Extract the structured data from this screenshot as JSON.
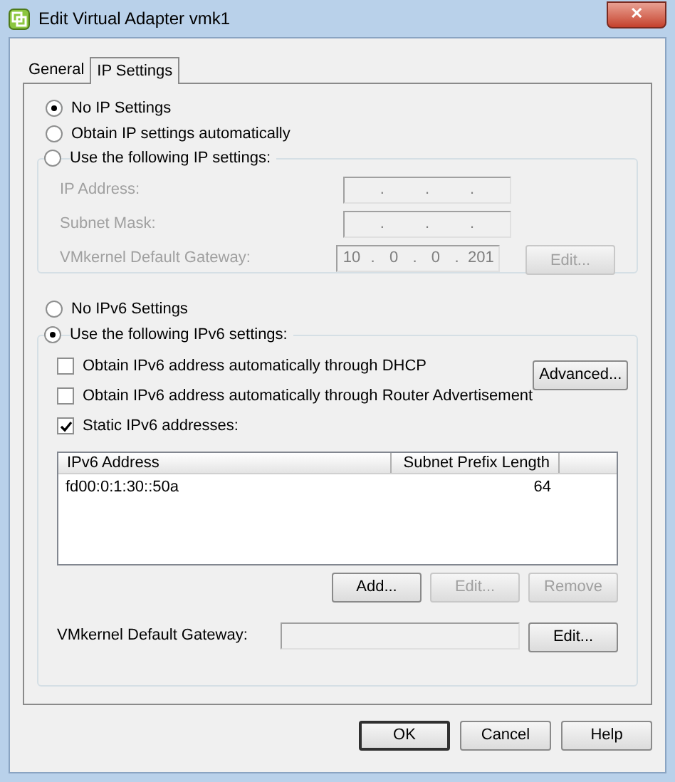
{
  "window": {
    "title": "Edit Virtual Adapter vmk1",
    "close": "✕"
  },
  "tabs": [
    {
      "label": "General",
      "selected": false
    },
    {
      "label": "IP Settings",
      "selected": true
    }
  ],
  "ipv4": {
    "options": [
      {
        "label": "No IP Settings",
        "selected": true
      },
      {
        "label": "Obtain IP settings automatically",
        "selected": false
      },
      {
        "label": "Use the following IP settings:",
        "selected": false
      }
    ],
    "fields": [
      {
        "label": "IP Address:",
        "disabled": true,
        "separators": [
          ".",
          ".",
          "."
        ]
      },
      {
        "label": "Subnet Mask:",
        "disabled": true,
        "separators": [
          ".",
          ".",
          "."
        ]
      },
      {
        "label": "VMkernel Default Gateway:",
        "disabled": true,
        "separators": [
          ".",
          ".",
          "."
        ],
        "octets": [
          "10",
          "0",
          "0",
          "201"
        ],
        "button": {
          "label": "Edit...",
          "disabled": true
        }
      }
    ]
  },
  "ipv6": {
    "options": [
      {
        "label": "No IPv6 Settings",
        "selected": false
      },
      {
        "label": "Use the following IPv6 settings:",
        "selected": true
      }
    ],
    "checkboxes": [
      {
        "label": "Obtain IPv6 address automatically through DHCP",
        "checked": false
      },
      {
        "label": "Obtain IPv6 address automatically through Router Advertisement",
        "checked": false
      },
      {
        "label": "Static IPv6 addresses:",
        "checked": true
      }
    ],
    "advanced_button": {
      "label": "Advanced...",
      "disabled": false
    },
    "table": {
      "columns": [
        "IPv6 Address",
        "Subnet Prefix Length"
      ],
      "rows": [
        [
          "fd00:0:1:30::50a",
          "64"
        ]
      ]
    },
    "table_buttons": [
      {
        "label": "Add...",
        "disabled": false
      },
      {
        "label": "Edit...",
        "disabled": true
      },
      {
        "label": "Remove",
        "disabled": true
      }
    ],
    "gateway": {
      "label": "VMkernel Default Gateway:",
      "button": {
        "label": "Edit...",
        "disabled": false
      }
    }
  },
  "buttons": [
    {
      "label": "OK",
      "default": true
    },
    {
      "label": "Cancel",
      "default": false
    },
    {
      "label": "Help",
      "default": false
    }
  ]
}
